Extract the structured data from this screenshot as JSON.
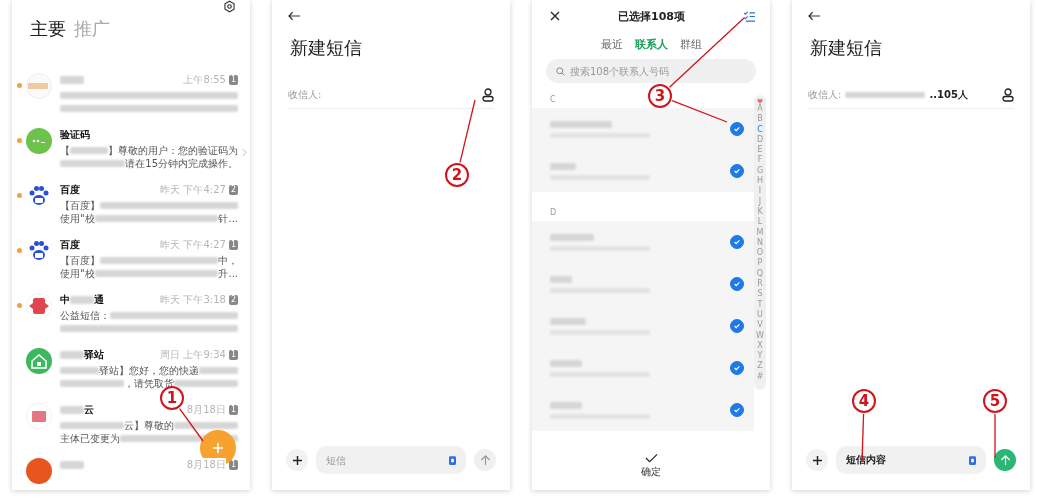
{
  "inbox": {
    "tabs": [
      {
        "label": "主要",
        "selected": true
      },
      {
        "label": "推广",
        "selected": false
      }
    ],
    "conversations": [
      {
        "unread": true,
        "kind": "blurred",
        "name": [
          {
            "kind": "blur"
          }
        ],
        "time": "上午8:55",
        "badge": "1",
        "chevron": false,
        "lines": [
          [
            {
              "kind": "blur"
            }
          ],
          [
            {
              "kind": "blur"
            }
          ]
        ]
      },
      {
        "unread": true,
        "kind": "code",
        "name": [
          {
            "kind": "text",
            "text": "验证码"
          }
        ],
        "chevron": true,
        "lines": [
          [
            {
              "kind": "text",
              "text": "【"
            },
            {
              "kind": "blur"
            },
            {
              "kind": "text",
              "text": "】尊敬的用户：您的验证码为"
            }
          ],
          [
            {
              "kind": "blur"
            },
            {
              "kind": "text",
              "text": "请在15分钟内完成操作。"
            }
          ]
        ]
      },
      {
        "unread": true,
        "kind": "paw",
        "name": [
          {
            "kind": "text",
            "text": "百度"
          }
        ],
        "time": "昨天 下午4:27",
        "badge": "2",
        "chevron": false,
        "lines": [
          [
            {
              "kind": "text",
              "text": "【百度】"
            },
            {
              "kind": "blur"
            }
          ],
          [
            {
              "kind": "text",
              "text": "使用\"校"
            },
            {
              "kind": "blur"
            },
            {
              "kind": "text",
              "text": "针..."
            }
          ]
        ]
      },
      {
        "unread": true,
        "kind": "paw",
        "name": [
          {
            "kind": "text",
            "text": "百度"
          }
        ],
        "time": "昨天 下午4:27",
        "badge": "1",
        "chevron": false,
        "lines": [
          [
            {
              "kind": "text",
              "text": "【百度】"
            },
            {
              "kind": "blur"
            },
            {
              "kind": "text",
              "text": "中，"
            }
          ],
          [
            {
              "kind": "text",
              "text": "使用\"校"
            },
            {
              "kind": "blur"
            },
            {
              "kind": "text",
              "text": "升..."
            }
          ]
        ]
      },
      {
        "unread": true,
        "kind": "red",
        "name": [
          {
            "kind": "text",
            "text": "中"
          },
          {
            "kind": "blur"
          },
          {
            "kind": "text",
            "text": "通"
          }
        ],
        "time": "昨天 下午3:18",
        "badge": "2",
        "chevron": false,
        "lines": [
          [
            {
              "kind": "text",
              "text": "公益短信："
            },
            {
              "kind": "blur"
            }
          ],
          [
            {
              "kind": "blur"
            }
          ]
        ]
      },
      {
        "unread": false,
        "kind": "house",
        "name": [
          {
            "kind": "blur"
          },
          {
            "kind": "text",
            "text": "驿站"
          }
        ],
        "time": "周日 上午9:34",
        "badge": "1",
        "chevron": false,
        "lines": [
          [
            {
              "kind": "blur"
            },
            {
              "kind": "text",
              "text": "驿站】您好，您的快递"
            },
            {
              "kind": "blur"
            }
          ],
          [
            {
              "kind": "blur"
            },
            {
              "kind": "text",
              "text": "，请凭取货"
            },
            {
              "kind": "blur"
            }
          ]
        ]
      },
      {
        "unread": false,
        "kind": "red-block",
        "name": [
          {
            "kind": "blur"
          },
          {
            "kind": "text",
            "text": "云"
          }
        ],
        "time": "8月18日",
        "badge": "1",
        "chevron": false,
        "lines": [
          [
            {
              "kind": "blur"
            },
            {
              "kind": "text",
              "text": "云】尊敬的"
            },
            {
              "kind": "blur"
            }
          ],
          [
            {
              "kind": "text",
              "text": "主体已变更为"
            },
            {
              "kind": "blur"
            }
          ]
        ]
      },
      {
        "unread": false,
        "kind": "orange",
        "name": [
          {
            "kind": "blur"
          }
        ],
        "time": "8月18日",
        "badge": "1",
        "chevron": false
      }
    ]
  },
  "compose_screens": [
    {
      "title": "新建短信",
      "recipient_label": "收信人:",
      "recipients_blurred": false,
      "message_placeholder": "短信",
      "send_enabled": false
    },
    {
      "title": "新建短信",
      "recipient_label": "收信人:",
      "recipients_blurred": true,
      "recipient_count": "..105人",
      "message_value": "短信内容",
      "send_enabled": true
    }
  ],
  "contact_picker": {
    "title": "已选择108项",
    "tabs": [
      {
        "label": "最近",
        "selected": false
      },
      {
        "label": "联系人",
        "selected": true
      },
      {
        "label": "群组",
        "selected": false
      }
    ],
    "search_placeholder": "搜索108个联系人号码",
    "sections": [
      {
        "letter": "C",
        "contacts": [
          {
            "checked": true
          },
          {
            "checked": true
          }
        ]
      },
      {
        "letter": "D",
        "contacts": [
          {
            "checked": true
          },
          {
            "checked": true
          },
          {
            "checked": true
          },
          {
            "checked": true
          },
          {
            "checked": true
          }
        ]
      }
    ],
    "index": [
      {
        "label": "A",
        "selected": false
      },
      {
        "label": "B",
        "selected": false
      },
      {
        "label": "C",
        "selected": true
      },
      {
        "label": "D",
        "selected": false
      },
      {
        "label": "E",
        "selected": false
      },
      {
        "label": "F",
        "selected": false
      },
      {
        "label": "G",
        "selected": false
      },
      {
        "label": "H",
        "selected": false
      },
      {
        "label": "I",
        "selected": false
      },
      {
        "label": "J",
        "selected": false
      },
      {
        "label": "K",
        "selected": false
      },
      {
        "label": "L",
        "selected": false
      },
      {
        "label": "M",
        "selected": false
      },
      {
        "label": "N",
        "selected": false
      },
      {
        "label": "O",
        "selected": false
      },
      {
        "label": "P",
        "selected": false
      },
      {
        "label": "Q",
        "selected": false
      },
      {
        "label": "R",
        "selected": false
      },
      {
        "label": "S",
        "selected": false
      },
      {
        "label": "T",
        "selected": false
      },
      {
        "label": "U",
        "selected": false
      },
      {
        "label": "V",
        "selected": false
      },
      {
        "label": "W",
        "selected": false
      },
      {
        "label": "X",
        "selected": false
      },
      {
        "label": "Y",
        "selected": false
      },
      {
        "label": "Z",
        "selected": false
      },
      {
        "label": "#",
        "selected": false
      }
    ],
    "confirm": "确定"
  },
  "annotations": [
    {
      "number": "1"
    },
    {
      "number": "2"
    },
    {
      "number": "3"
    },
    {
      "number": "4"
    },
    {
      "number": "5"
    }
  ]
}
